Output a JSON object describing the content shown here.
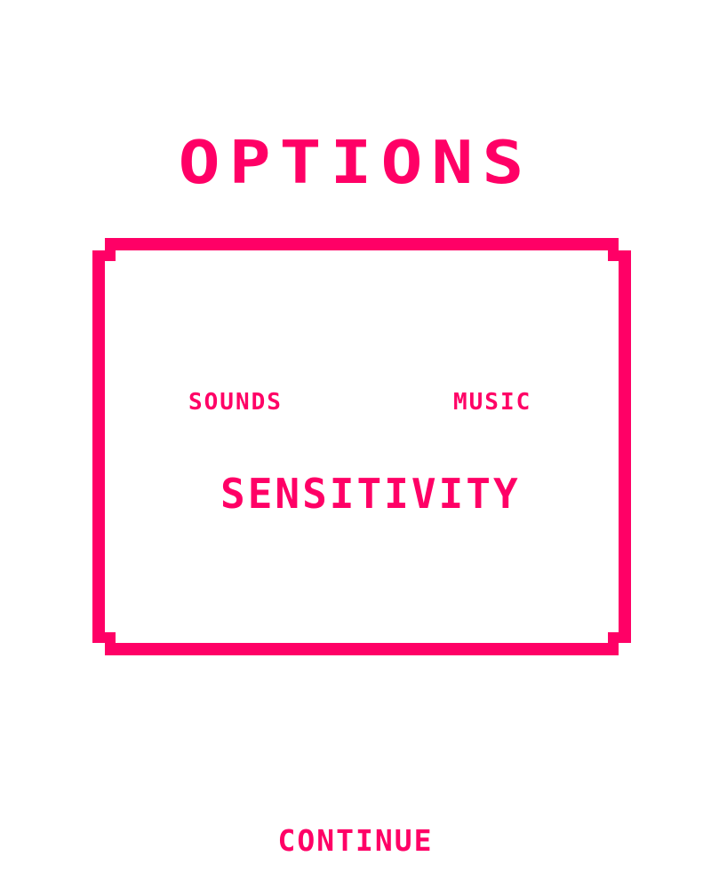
{
  "screen": {
    "title": "OPTIONS"
  },
  "panel": {
    "sounds_label": "SOUNDS",
    "music_label": "MUSIC",
    "sensitivity_label": "SENSITIVITY"
  },
  "footer": {
    "continue_label": "CONTINUE"
  },
  "colors": {
    "accent": "#ff0066",
    "background": "#ffffff"
  }
}
